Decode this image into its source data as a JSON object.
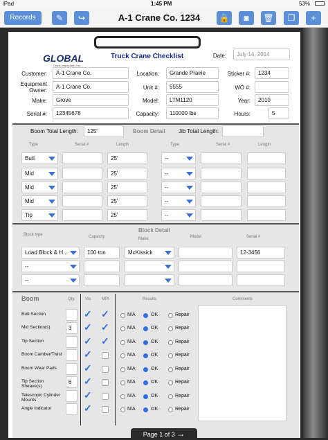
{
  "status": {
    "device": "iPad",
    "time": "1:45 PM",
    "battery": "53%"
  },
  "toolbar": {
    "records_label": "Records",
    "title": "A-1 Crane Co. 1234"
  },
  "header": {
    "logo_text": "GLOBAL",
    "logo_sub": "Crane Inspections Inc.",
    "form_title": "Truck Crane Checklist",
    "date_label": "Date:",
    "date_value": "July 14, 2014",
    "customer_label": "Customer:",
    "customer_value": "A-1 Crane Co.",
    "owner_label": "Equipment Owner:",
    "owner_value": "A-1 Crane Co.",
    "make_label": "Make:",
    "make_value": "Grove",
    "serial_label": "Serial #:",
    "serial_value": "12345678",
    "location_label": "Location:",
    "location_value": "Grande Prairie",
    "unit_label": "Unit #:",
    "unit_value": "5555",
    "model_label": "Model:",
    "model_value": "LTM1120",
    "capacity_label": "Capacity:",
    "capacity_value": "110000 lbs",
    "sticker_label": "Sticker #:",
    "sticker_value": "1234",
    "wo_label": "WO #:",
    "wo_value": "",
    "year_label": "Year:",
    "year_value": "2010",
    "hours_label": "Hours:",
    "hours_value": "5"
  },
  "boom_detail": {
    "title": "Boom Detail",
    "total_length_label": "Boom Total Length:",
    "total_length_value": "125'",
    "jib_length_label": "Jib Total Length:",
    "jib_length_value": "",
    "col_type": "Type",
    "col_serial": "Serial #",
    "col_length": "Length",
    "boom_rows": [
      {
        "type": "Butt",
        "length": "25'"
      },
      {
        "type": "Mid",
        "length": "25'"
      },
      {
        "type": "Mid",
        "length": "25'"
      },
      {
        "type": "Mid",
        "length": "25'"
      },
      {
        "type": "Tip",
        "length": "25'"
      }
    ],
    "jib_rows": [
      "--",
      "--",
      "--",
      "--",
      "--"
    ]
  },
  "block_detail": {
    "title": "Block Detail",
    "col_block_type": "Block type",
    "col_capacity": "Capacity",
    "col_make": "Make",
    "col_model": "Model",
    "col_serial": "Serial #",
    "rows": [
      {
        "type": "Load Block & H...",
        "capacity": "100 ton",
        "make": "McKissick",
        "model": "",
        "serial": "12-3456"
      },
      {
        "type": "--",
        "capacity": "",
        "make": "",
        "model": "",
        "serial": ""
      },
      {
        "type": "--",
        "capacity": "",
        "make": "",
        "model": "",
        "serial": ""
      }
    ]
  },
  "boom_inspect": {
    "title": "Boom",
    "col_qty": "Qty.",
    "col_vis": "Vis",
    "col_mpi": "MPI",
    "col_results": "Results",
    "col_comments": "Comments",
    "opt_na": "N/A",
    "opt_ok": "OK",
    "opt_repair": "Repair",
    "items": [
      {
        "label": "Butt Section",
        "qty": ""
      },
      {
        "label": "Mid Section(s)",
        "qty": "3"
      },
      {
        "label": "Tip Section",
        "qty": ""
      },
      {
        "label": "Boom Camber/Twist",
        "qty": ""
      },
      {
        "label": "Boom Wear Pads",
        "qty": ""
      },
      {
        "label": "Tip Section Sheave(s)",
        "qty": "6"
      },
      {
        "label": "Telescopic Cylinder Mounts",
        "qty": ""
      },
      {
        "label": "Angle Indicator",
        "qty": ""
      }
    ]
  },
  "footer": {
    "page": "Page 1 of 3",
    "arrow": "→"
  }
}
